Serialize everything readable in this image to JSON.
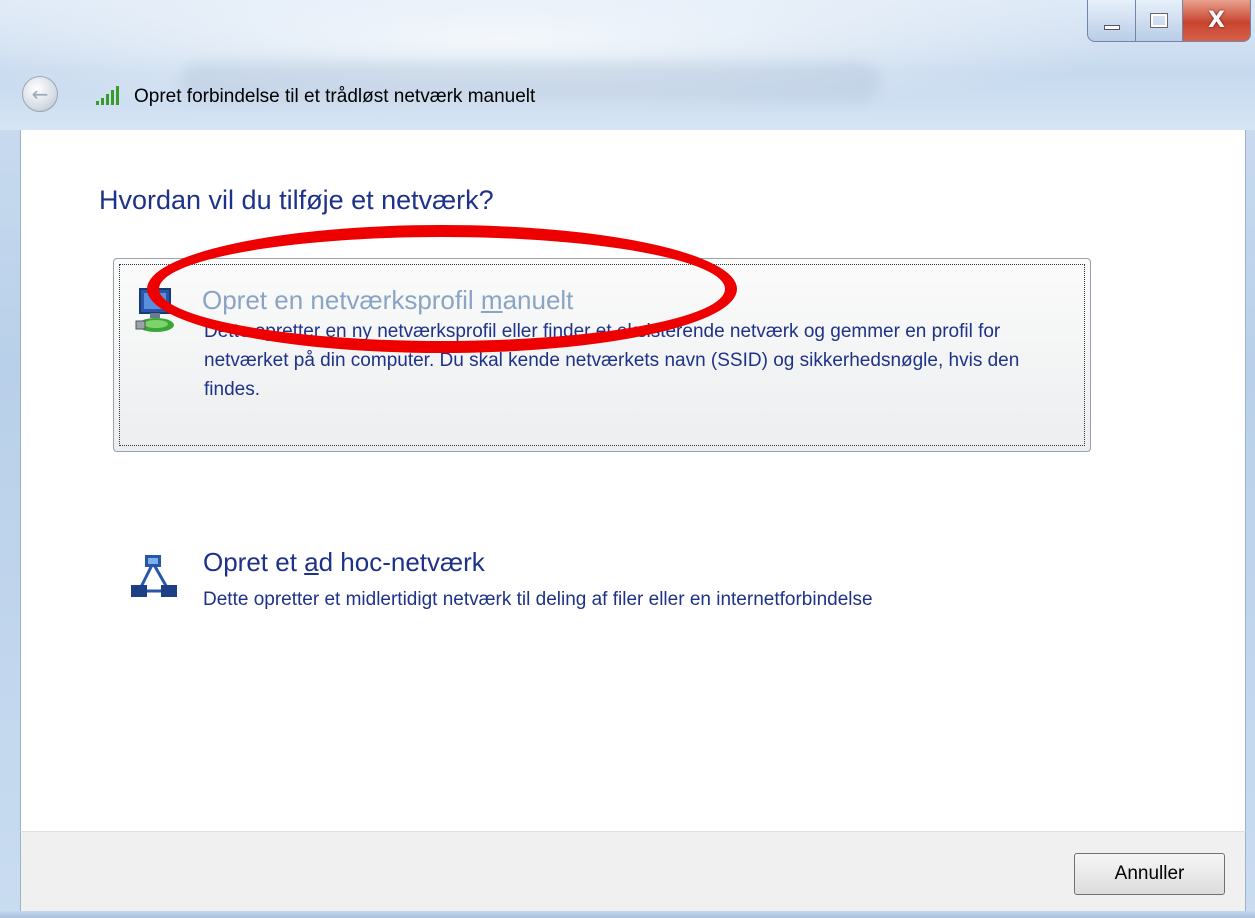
{
  "window": {
    "title": "Opret forbindelse til et trådløst netværk manuelt",
    "caption_buttons": {
      "minimize": "minimize",
      "maximize": "maximize",
      "close": "X"
    }
  },
  "main": {
    "heading": "Hvordan vil du tilføje et netværk?",
    "options": [
      {
        "title_before": "Opret en netværksprofil ",
        "title_accel": "m",
        "title_after": "anuelt",
        "description": "Dette opretter en ny netværksprofil eller finder et eksisterende netværk og gemmer en profil for netværket på din computer. Du skal kende netværkets navn (SSID) og sikkerhedsnøgle, hvis den findes.",
        "icon": "network-profile-icon"
      },
      {
        "title_before": "Opret et ",
        "title_accel": "a",
        "title_after": "d hoc-netværk",
        "description": "Dette opretter et midlertidigt netværk til deling af filer eller en internetforbindelse",
        "icon": "ad-hoc-network-icon"
      }
    ]
  },
  "footer": {
    "cancel_label": "Annuller"
  },
  "colors": {
    "heading": "#1e3287",
    "annotation": "#ee0000",
    "link_text": "#1e3287"
  }
}
